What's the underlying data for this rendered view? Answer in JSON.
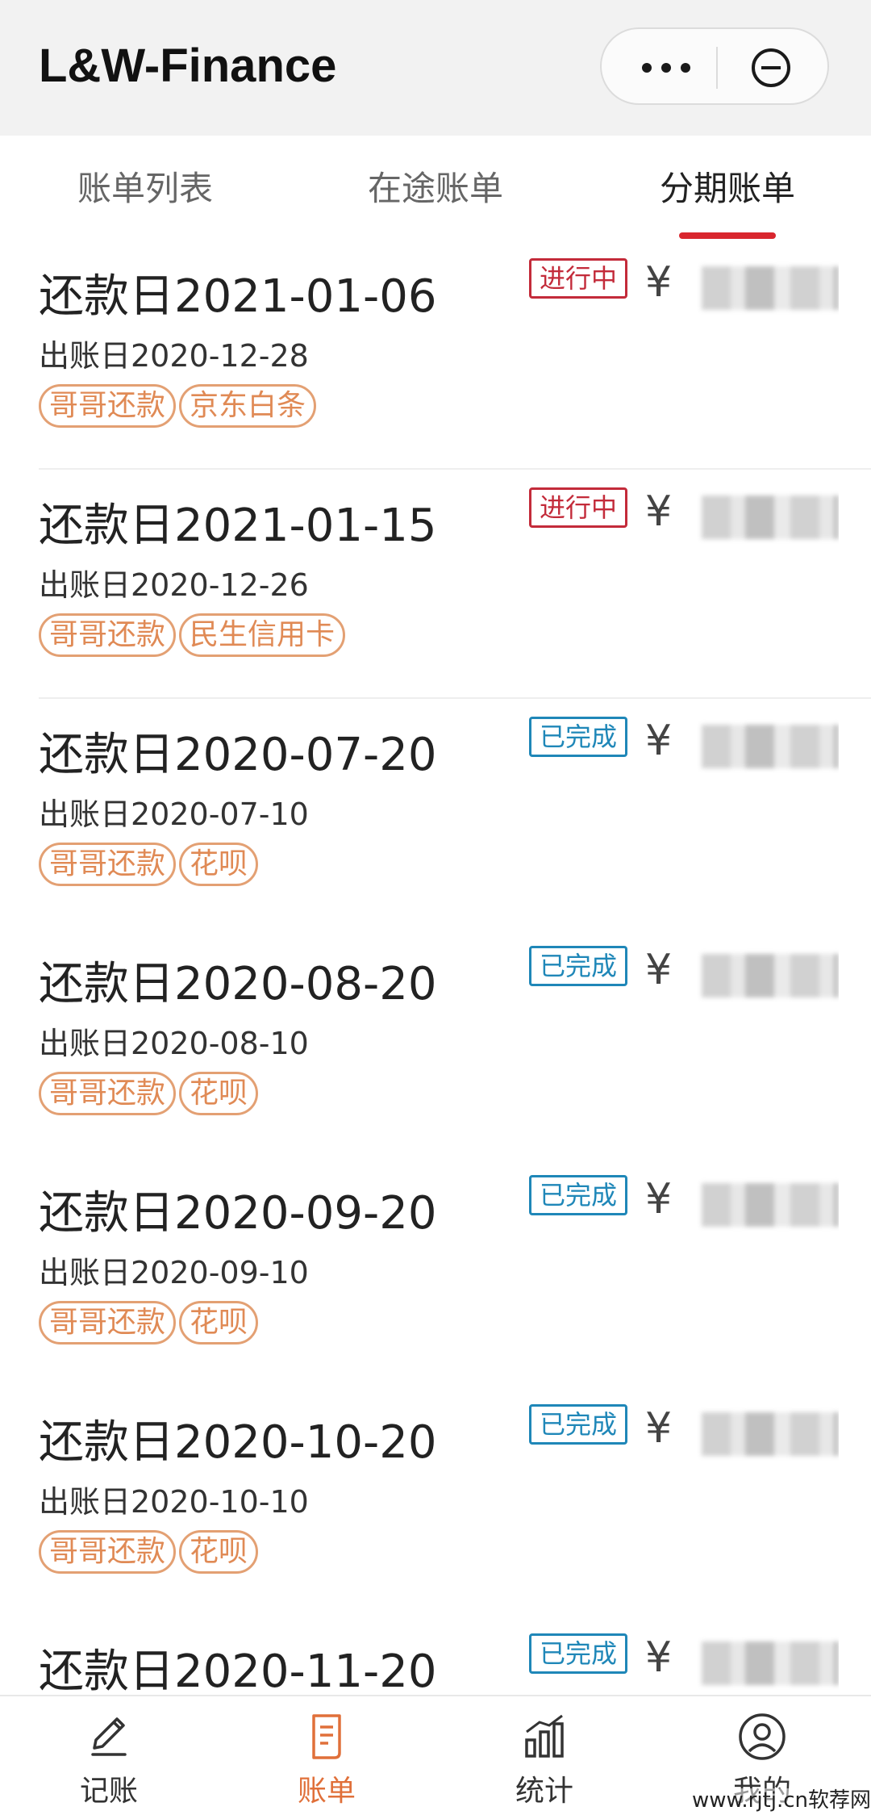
{
  "header": {
    "title": "L&W-Finance"
  },
  "tabs": [
    {
      "label": "账单列表",
      "active": false
    },
    {
      "label": "在途账单",
      "active": false
    },
    {
      "label": "分期账单",
      "active": true
    }
  ],
  "bills": [
    {
      "repay_date": "还款日2021-01-06",
      "statement_date": "出账日2020-12-28",
      "status": "进行中",
      "status_type": "ongoing",
      "amount_prefix": "¥",
      "tags": [
        "哥哥还款",
        "京东白条"
      ]
    },
    {
      "repay_date": "还款日2021-01-15",
      "statement_date": "出账日2020-12-26",
      "status": "进行中",
      "status_type": "ongoing",
      "amount_prefix": "¥",
      "tags": [
        "哥哥还款",
        "民生信用卡"
      ]
    },
    {
      "repay_date": "还款日2020-07-20",
      "statement_date": "出账日2020-07-10",
      "status": "已完成",
      "status_type": "done",
      "amount_prefix": "¥",
      "tags": [
        "哥哥还款",
        "花呗"
      ]
    },
    {
      "repay_date": "还款日2020-08-20",
      "statement_date": "出账日2020-08-10",
      "status": "已完成",
      "status_type": "done",
      "amount_prefix": "¥",
      "tags": [
        "哥哥还款",
        "花呗"
      ]
    },
    {
      "repay_date": "还款日2020-09-20",
      "statement_date": "出账日2020-09-10",
      "status": "已完成",
      "status_type": "done",
      "amount_prefix": "¥",
      "tags": [
        "哥哥还款",
        "花呗"
      ]
    },
    {
      "repay_date": "还款日2020-10-20",
      "statement_date": "出账日2020-10-10",
      "status": "已完成",
      "status_type": "done",
      "amount_prefix": "¥",
      "tags": [
        "哥哥还款",
        "花呗"
      ]
    },
    {
      "repay_date": "还款日2020-11-20",
      "statement_date": "",
      "status": "已完成",
      "status_type": "done",
      "amount_prefix": "¥",
      "tags": []
    }
  ],
  "bottom_nav": [
    {
      "label": "记账",
      "icon": "pen-icon",
      "active": false
    },
    {
      "label": "账单",
      "icon": "bill-document-icon",
      "active": true
    },
    {
      "label": "统计",
      "icon": "bar-chart-icon",
      "active": false
    },
    {
      "label": "我的",
      "icon": "user-profile-icon",
      "active": false
    }
  ],
  "watermark": "www.rjtj.cn软荐网",
  "colors": {
    "accent_red": "#d9262e",
    "status_ongoing": "#c32b3a",
    "status_done": "#1f87b8",
    "tag_orange": "#e08a55",
    "nav_active": "#e0703a"
  }
}
